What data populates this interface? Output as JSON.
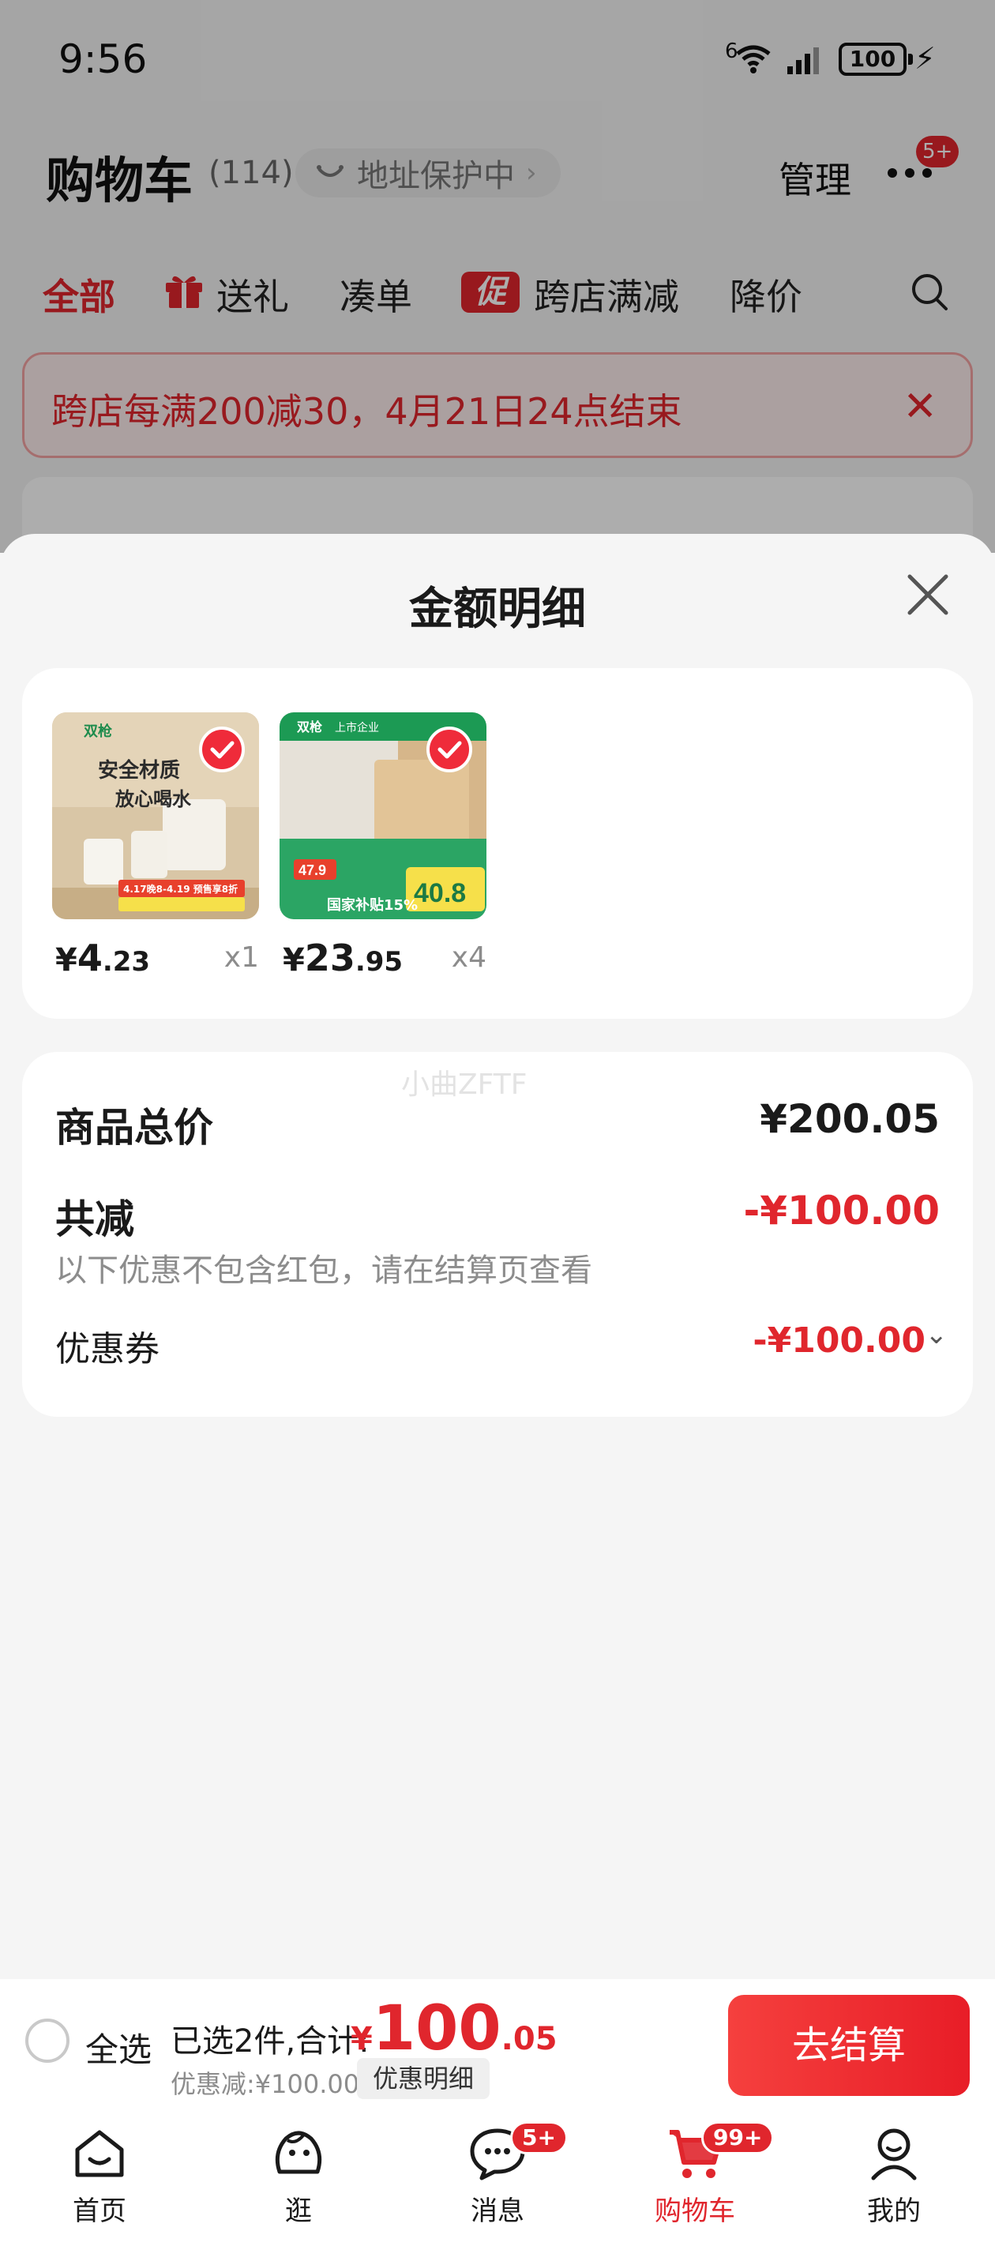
{
  "status_bar": {
    "time": "9:56",
    "network": "6",
    "battery": "100"
  },
  "header": {
    "title": "购物车",
    "count": "(114)",
    "address_protection": "地址保护中",
    "manage": "管理",
    "more_badge": "5+"
  },
  "tabs": [
    {
      "label": "全部"
    },
    {
      "label": "送礼"
    },
    {
      "label": "凑单"
    },
    {
      "label": "跨店满减",
      "tag": "促"
    },
    {
      "label": "降价"
    }
  ],
  "promo_banner": {
    "text": "跨店每满200减30，4月21日24点结束"
  },
  "sheet": {
    "title": "金额明细",
    "items": [
      {
        "price_symbol": "¥",
        "price_int": "4",
        "price_dec": ".23",
        "qty": "x1",
        "brand": "双枪",
        "img_line1": "安全材质",
        "img_line2": "放心喝水",
        "img_promo": "4.17晚8-4.19 预售享8折"
      },
      {
        "price_symbol": "¥",
        "price_int": "23",
        "price_dec": ".95",
        "qty": "x4",
        "brand": "双枪",
        "img_tag": "上市企业",
        "img_price": "47.9",
        "img_subsidy": "国家补贴15%",
        "img_final": "40.8"
      }
    ],
    "watermark": "小曲ZFTF",
    "summary": {
      "total_label": "商品总价",
      "total_value": "¥200.05",
      "discount_label": "共减",
      "discount_value": "-¥100.00",
      "discount_note": "以下优惠不包含红包，请在结算页查看",
      "coupon_label": "优惠券",
      "coupon_value": "-¥100.00"
    }
  },
  "checkout": {
    "select_all": "全选",
    "selected_text": "已选2件,合计:",
    "total_symbol": "¥",
    "total_int": "100",
    "total_dec": ".05",
    "discount_text": "优惠减:¥100.00",
    "detail_chip": "优惠明细",
    "button": "去结算"
  },
  "nav": [
    {
      "label": "首页",
      "icon": "home-icon"
    },
    {
      "label": "逛",
      "icon": "browse-icon"
    },
    {
      "label": "消息",
      "icon": "message-icon",
      "badge": "5+"
    },
    {
      "label": "购物车",
      "icon": "cart-icon",
      "badge": "99+",
      "active": true
    },
    {
      "label": "我的",
      "icon": "profile-icon"
    }
  ],
  "colors": {
    "accent": "#e0262d",
    "check": "#ef2b3a",
    "background": "#f5f5f5"
  }
}
